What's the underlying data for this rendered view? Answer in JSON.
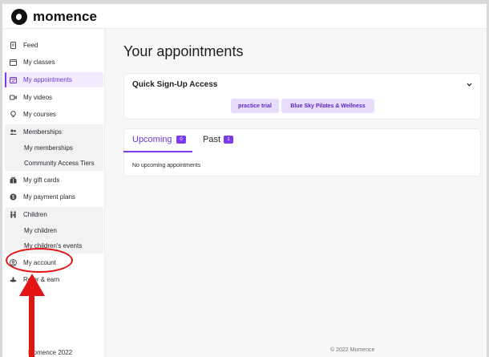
{
  "brand": {
    "name": "momence"
  },
  "sidebar": {
    "items": [
      {
        "label": "Feed",
        "icon": "document-icon"
      },
      {
        "label": "My classes",
        "icon": "calendar-icon"
      },
      {
        "label": "My appointments",
        "icon": "calendar-check-icon",
        "active": true
      },
      {
        "label": "My videos",
        "icon": "video-icon"
      },
      {
        "label": "My courses",
        "icon": "lightbulb-icon"
      },
      {
        "label": "Memberships",
        "icon": "users-icon"
      },
      {
        "label": "My gift cards",
        "icon": "gift-icon"
      },
      {
        "label": "My payment plans",
        "icon": "dollar-icon"
      },
      {
        "label": "Children",
        "icon": "family-icon"
      },
      {
        "label": "My account",
        "icon": "user-circle-icon"
      },
      {
        "label": "Refer & earn",
        "icon": "share-icon"
      }
    ],
    "memberships_sub": [
      "My memberships",
      "Community Access Tiers"
    ],
    "children_sub": [
      "My children",
      "My children's events"
    ],
    "footer": "Momence 2022"
  },
  "main": {
    "title": "Your appointments",
    "quick_signup": {
      "title": "Quick Sign-Up Access",
      "tags": [
        "practice trial",
        "Blue Sky Pilates & Wellness"
      ]
    },
    "tabs": [
      {
        "label": "Upcoming",
        "count": "0",
        "active": true
      },
      {
        "label": "Past",
        "count": "1",
        "active": false
      }
    ],
    "empty_message": "No upcoming appointments",
    "footer": "© 2022 Momence"
  },
  "colors": {
    "accent": "#7c3aed",
    "active_bg": "#f1ebfd",
    "tag_bg": "#e8dcfd",
    "annotation": "#e41414"
  }
}
